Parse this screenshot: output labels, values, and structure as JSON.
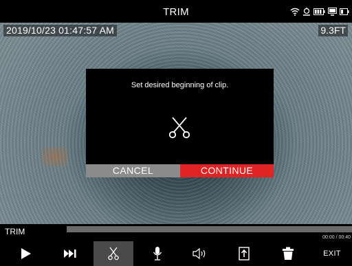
{
  "header": {
    "title": "TRIM"
  },
  "status_icons": [
    "wifi-icon",
    "gps-icon",
    "battery-icon",
    "monitor-icon",
    "camera-battery-icon"
  ],
  "overlay": {
    "timestamp": "2019/10/23 01:47:57 AM",
    "distance": "9.3FT"
  },
  "dialog": {
    "message": "Set desired beginning of clip.",
    "icon": "scissors-icon",
    "cancel_label": "CANCEL",
    "continue_label": "CONTINUE",
    "colors": {
      "continue": "#e02424",
      "cancel": "#8b8b8b"
    }
  },
  "timeline": {
    "label": "TRIM",
    "time": "00:00 / 00:40"
  },
  "toolbar": {
    "items": [
      "play-icon",
      "skip-next-icon",
      "scissors-icon",
      "microphone-icon",
      "speaker-icon",
      "export-icon",
      "trash-icon"
    ],
    "active": "scissors-icon",
    "exit_label": "EXIT"
  }
}
